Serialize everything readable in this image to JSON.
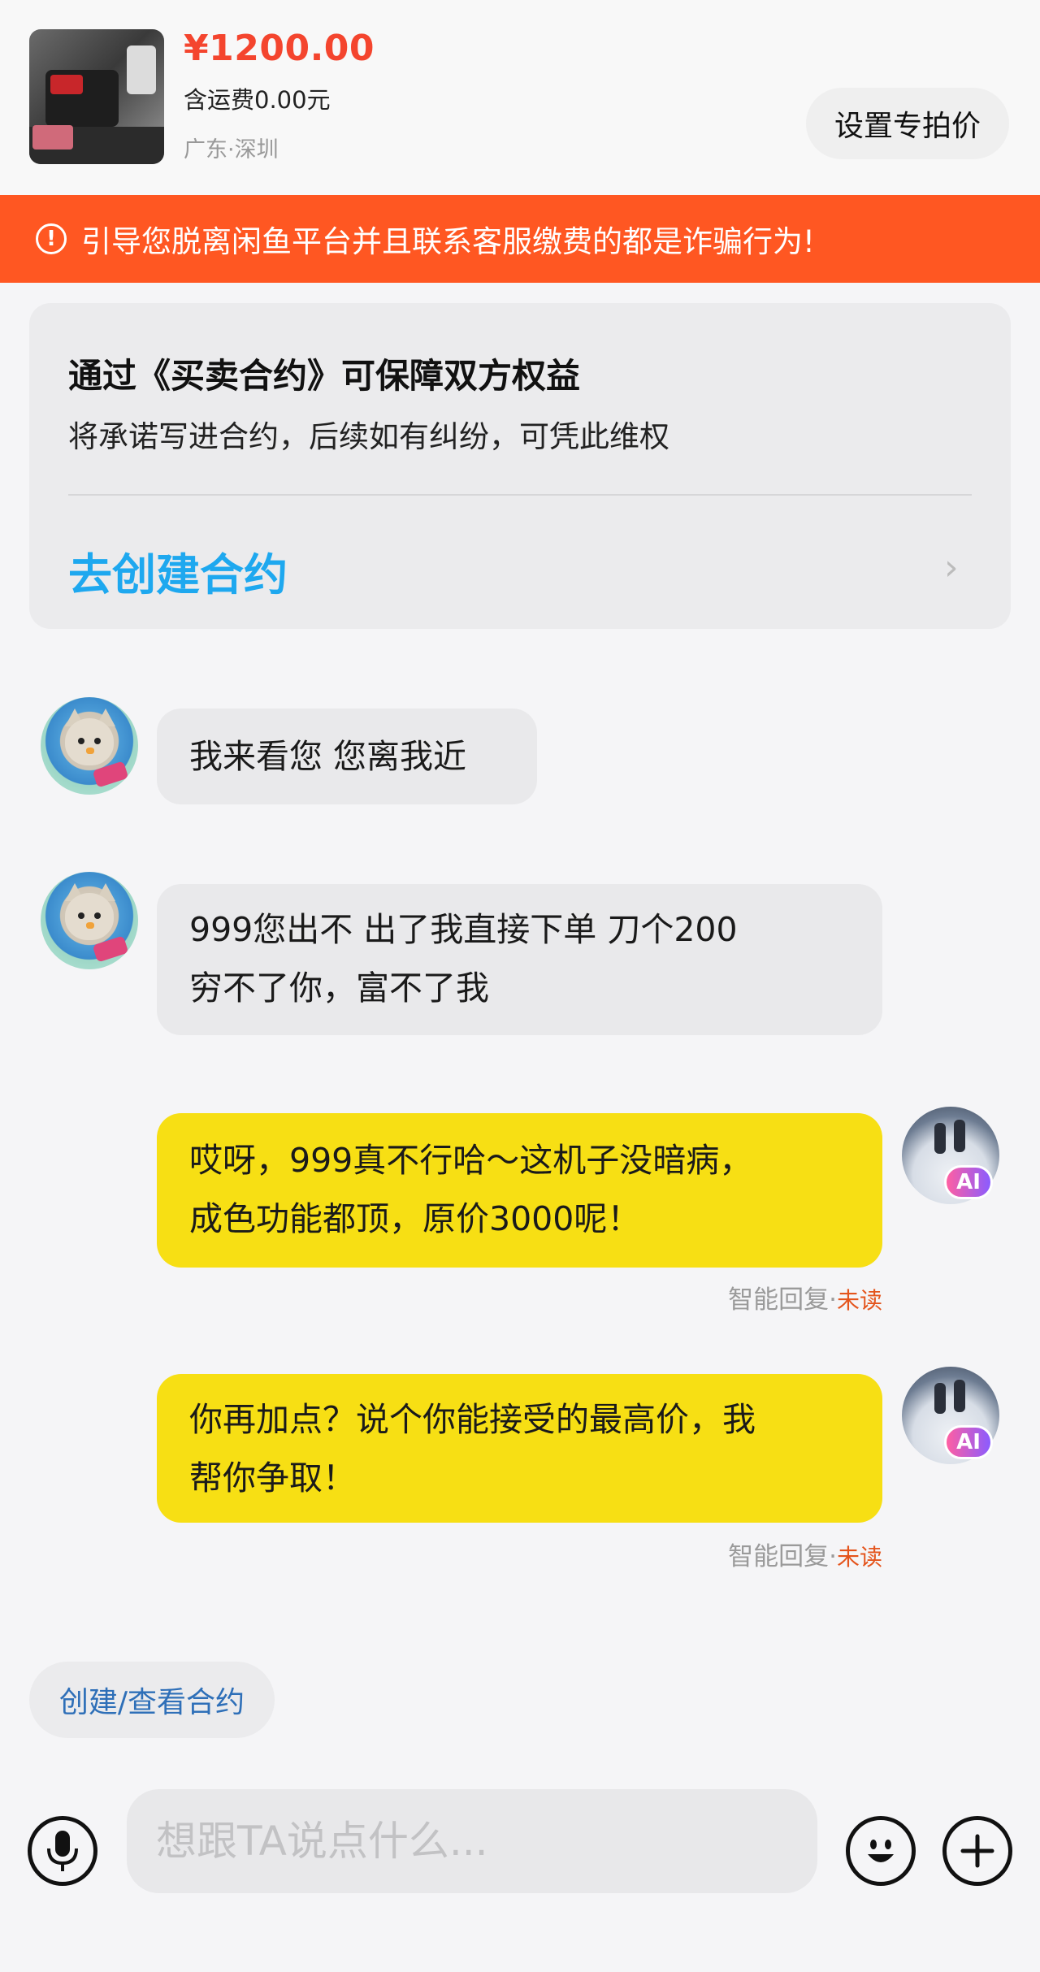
{
  "product": {
    "price": "¥1200.00",
    "shipping": "含运费0.00元",
    "location": "广东·深圳",
    "special_price_button": "设置专拍价"
  },
  "warning": {
    "icon": "!",
    "text": "引导您脱离闲鱼平台并且联系客服缴费的都是诈骗行为!"
  },
  "contract_card": {
    "title": "通过《买卖合约》可保障双方权益",
    "subtitle": "将承诺写进合约，后续如有纠纷，可凭此维权",
    "link": "去创建合约",
    "chevron": "›"
  },
  "messages": [
    {
      "side": "in",
      "lines": [
        "我来看您 您离我近"
      ]
    },
    {
      "side": "in",
      "lines": [
        "999您出不  出了我直接下单  刀个200",
        "穷不了你，富不了我"
      ]
    },
    {
      "side": "out",
      "lines": [
        "哎呀，999真不行哈～这机子没暗病，",
        "成色功能都顶，原价3000呢！"
      ],
      "status": "智能回复",
      "status_sep": "·",
      "unread": "未读"
    },
    {
      "side": "out",
      "lines": [
        "你再加点？说个你能接受的最高价，我",
        "帮你争取！"
      ],
      "status": "智能回复",
      "status_sep": "·",
      "unread": "未读"
    }
  ],
  "ai_badge": "AI",
  "contract_chip": "创建/查看合约",
  "input": {
    "placeholder": "想跟TA说点什么..."
  },
  "icons": {
    "voice": "microphone-icon",
    "emoji": "emoji-icon",
    "plus": "plus-icon"
  },
  "colors": {
    "price": "#f4452e",
    "warning_bg": "#ff5722",
    "link": "#1ea8ef",
    "outgoing_bubble": "#f7df14",
    "incoming_bubble": "#e9e9eb",
    "unread": "#e4541c"
  }
}
